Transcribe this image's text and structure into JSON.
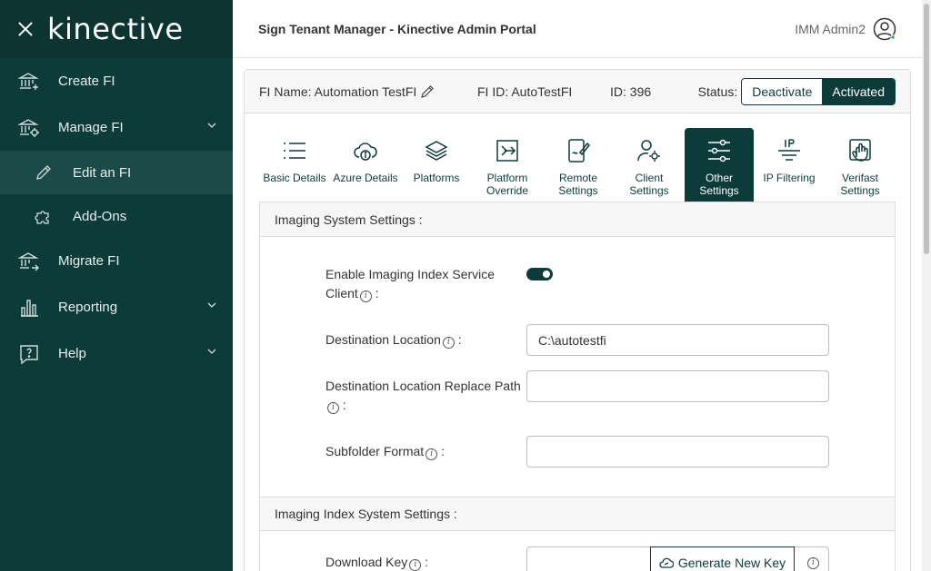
{
  "sidebar": {
    "brand": "kinective",
    "items": [
      {
        "label": "Create FI",
        "icon": "bank-plus-icon"
      },
      {
        "label": "Manage FI",
        "icon": "bank-gear-icon"
      },
      {
        "label": "Edit an FI",
        "icon": "pencil-icon"
      },
      {
        "label": "Add-Ons",
        "icon": "puzzle-icon"
      },
      {
        "label": "Migrate FI",
        "icon": "bank-arrow-icon"
      },
      {
        "label": "Reporting",
        "icon": "bar-chart-icon"
      },
      {
        "label": "Help",
        "icon": "help-bubble-icon"
      }
    ]
  },
  "header": {
    "title": "Sign Tenant Manager - Kinective Admin Portal",
    "user": "IMM Admin2"
  },
  "fi": {
    "name": "FI Name: Automation TestFI",
    "fi_id": "FI ID: AutoTestFI",
    "id": "ID: 396",
    "status_label": "Status:",
    "deactivate": "Deactivate",
    "activated": "Activated"
  },
  "tabs": [
    {
      "l1": "Basic Details",
      "l2": ""
    },
    {
      "l1": "Azure Details",
      "l2": ""
    },
    {
      "l1": "Platforms",
      "l2": ""
    },
    {
      "l1": "Platform",
      "l2": "Override"
    },
    {
      "l1": "Remote",
      "l2": "Settings"
    },
    {
      "l1": "Client",
      "l2": "Settings"
    },
    {
      "l1": "Other",
      "l2": "Settings"
    },
    {
      "l1": "IP Filtering",
      "l2": ""
    },
    {
      "l1": "Verifast",
      "l2": "Settings"
    }
  ],
  "imaging": {
    "heading": "Imaging System Settings :",
    "enable_label_1": "Enable Imaging Index Service",
    "enable_label_2": "Client",
    "dest_label": "Destination Location",
    "dest_value": "C:\\autotestfi",
    "replace_label": "Destination Location Replace Path",
    "replace_value": "",
    "subfolder_label": "Subfolder Format",
    "subfolder_value": "",
    "colon": ":"
  },
  "index": {
    "heading": "Imaging Index System Settings :",
    "download_label": "Download Key",
    "generate": "Generate New Key"
  }
}
